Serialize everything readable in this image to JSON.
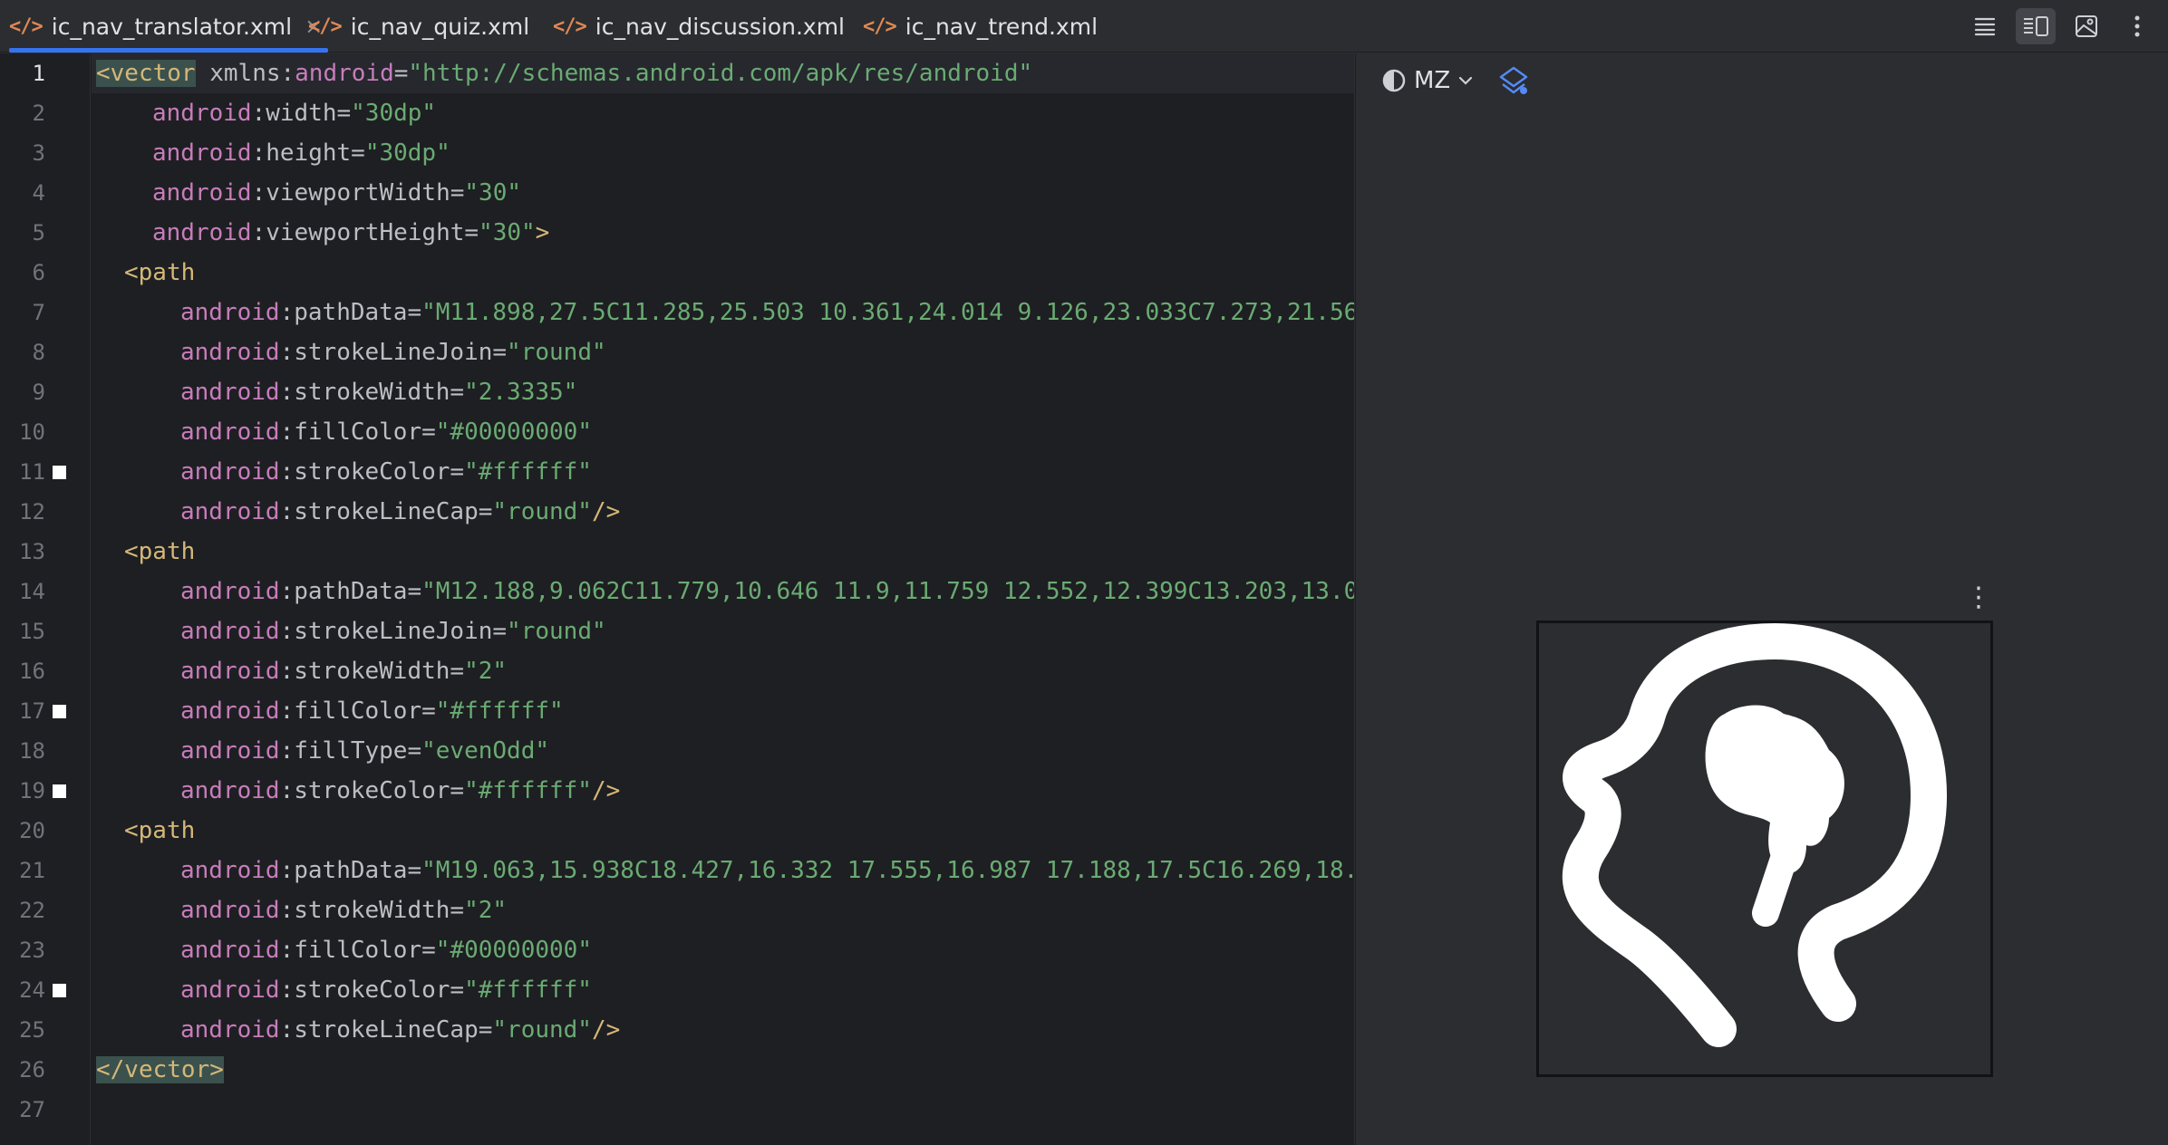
{
  "tabs": [
    {
      "label": "ic_nav_translator.xml",
      "active": true,
      "closable": true
    },
    {
      "label": "ic_nav_quiz.xml",
      "active": false
    },
    {
      "label": "ic_nav_discussion.xml",
      "active": false
    },
    {
      "label": "ic_nav_trend.xml",
      "active": false
    }
  ],
  "tab_icon": "</>",
  "close_glyph": "×",
  "toolbar": {
    "icons": [
      "code-view-icon",
      "split-view-icon",
      "design-view-icon",
      "more-vertical-icon"
    ],
    "selected": "split-view-icon"
  },
  "editor": {
    "line_numbers": [
      "1",
      "2",
      "3",
      "4",
      "5",
      "6",
      "7",
      "8",
      "9",
      "10",
      "11",
      "12",
      "13",
      "14",
      "15",
      "16",
      "17",
      "18",
      "19",
      "20",
      "21",
      "22",
      "23",
      "24",
      "25",
      "26",
      "27"
    ],
    "current_line": 1,
    "color_swatch_lines": [
      11,
      17,
      19,
      24
    ],
    "lines": {
      "l1": {
        "tag": "<vector",
        "rest_ns": " xmlns",
        "rest_colon": ":",
        "rest_attr": "android",
        "eq": "=",
        "val": "\"http://schemas.android.com/apk/res/android\""
      },
      "l2": {
        "ns": "android",
        "attr": ":width",
        "eq": "=",
        "val": "\"30dp\""
      },
      "l3": {
        "ns": "android",
        "attr": ":height",
        "eq": "=",
        "val": "\"30dp\""
      },
      "l4": {
        "ns": "android",
        "attr": ":viewportWidth",
        "eq": "=",
        "val": "\"30\""
      },
      "l5": {
        "ns": "android",
        "attr": ":viewportHeight",
        "eq": "=",
        "val": "\"30\"",
        "close": ">"
      },
      "l6": {
        "tag": "<path"
      },
      "l7": {
        "ns": "android",
        "attr": ":pathData",
        "eq": "=",
        "val": "\"M11.898,27.5C11.285,25.503 10.361,24.014 9.126,23.033C7.273,21.56"
      },
      "l8": {
        "ns": "android",
        "attr": ":strokeLineJoin",
        "eq": "=",
        "val": "\"round\""
      },
      "l9": {
        "ns": "android",
        "attr": ":strokeWidth",
        "eq": "=",
        "val": "\"2.3335\""
      },
      "l10": {
        "ns": "android",
        "attr": ":fillColor",
        "eq": "=",
        "val": "\"#00000000\""
      },
      "l11": {
        "ns": "android",
        "attr": ":strokeColor",
        "eq": "=",
        "val": "\"#ffffff\""
      },
      "l12": {
        "ns": "android",
        "attr": ":strokeLineCap",
        "eq": "=",
        "val": "\"round\"",
        "close": "/>"
      },
      "l13": {
        "tag": "<path"
      },
      "l14": {
        "ns": "android",
        "attr": ":pathData",
        "eq": "=",
        "val": "\"M12.188,9.062C11.779,10.646 11.9,11.759 12.552,12.399C13.203,13.0"
      },
      "l15": {
        "ns": "android",
        "attr": ":strokeLineJoin",
        "eq": "=",
        "val": "\"round\""
      },
      "l16": {
        "ns": "android",
        "attr": ":strokeWidth",
        "eq": "=",
        "val": "\"2\""
      },
      "l17": {
        "ns": "android",
        "attr": ":fillColor",
        "eq": "=",
        "val": "\"#ffffff\""
      },
      "l18": {
        "ns": "android",
        "attr": ":fillType",
        "eq": "=",
        "val": "\"evenOdd\""
      },
      "l19": {
        "ns": "android",
        "attr": ":strokeColor",
        "eq": "=",
        "val": "\"#ffffff\"",
        "close": "/>"
      },
      "l20": {
        "tag": "<path"
      },
      "l21": {
        "ns": "android",
        "attr": ":pathData",
        "eq": "=",
        "val": "\"M19.063,15.938C18.427,16.332 17.555,16.987 17.188,17.5C16.269,18."
      },
      "l22": {
        "ns": "android",
        "attr": ":strokeWidth",
        "eq": "=",
        "val": "\"2\""
      },
      "l23": {
        "ns": "android",
        "attr": ":fillColor",
        "eq": "=",
        "val": "\"#00000000\""
      },
      "l24": {
        "ns": "android",
        "attr": ":strokeColor",
        "eq": "=",
        "val": "\"#ffffff\""
      },
      "l25": {
        "ns": "android",
        "attr": ":strokeLineCap",
        "eq": "=",
        "val": "\"round\"",
        "close": "/>"
      },
      "l26": {
        "tag": "</vector>"
      }
    }
  },
  "preview": {
    "theme_label": "MZ",
    "more_glyph": "⋮",
    "icon_description": "head-with-brain-icon"
  },
  "colors": {
    "accent": "#3574f0",
    "tag": "#d5b778",
    "namespace": "#c77dbb",
    "string": "#6aab73",
    "check": "#5fb865",
    "bulb": "#f2c55c"
  }
}
